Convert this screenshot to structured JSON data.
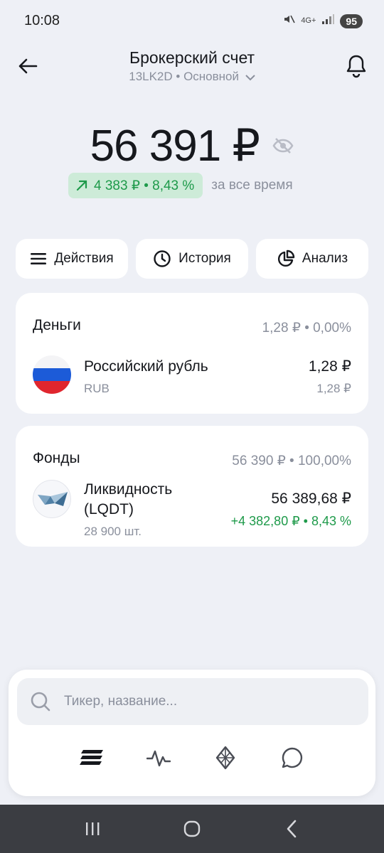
{
  "status_bar": {
    "time": "10:08",
    "network": "4G+",
    "battery": "95"
  },
  "header": {
    "title": "Брокерский счет",
    "account": "13LK2D • Основной"
  },
  "balance": {
    "value": "56 391 ₽",
    "change": "4 383 ₽ • 8,43 %",
    "change_label": "за все время",
    "change_color": "#1e9a4a"
  },
  "actions": [
    {
      "label": "Действия",
      "icon": "menu-icon"
    },
    {
      "label": "История",
      "icon": "clock-icon"
    },
    {
      "label": "Анализ",
      "icon": "pie-chart-icon"
    }
  ],
  "money": {
    "title": "Деньги",
    "summary": "1,28 ₽ • 0,00%",
    "items": [
      {
        "name": "Российский рубль",
        "ticker": "RUB",
        "value": "1,28 ₽",
        "sub_value": "1,28 ₽",
        "icon": "russia-flag-icon"
      }
    ]
  },
  "funds": {
    "title": "Фонды",
    "summary": "56 390 ₽ • 100,00%",
    "items": [
      {
        "name_line1": "Ликвидность",
        "name_line2": "(LQDT)",
        "quantity": "28 900 шт.",
        "value": "56 389,68 ₽",
        "change": "+4 382,80 ₽ • 8,43 %",
        "icon": "lqdt-fund-logo-icon"
      }
    ]
  },
  "search": {
    "placeholder": "Тикер, название..."
  },
  "bottom_nav": [
    "portfolio-icon",
    "pulse-icon",
    "crypto-icon",
    "chat-icon"
  ],
  "colors": {
    "positive": "#1e9a4a",
    "positive_bg": "#cdebd8",
    "muted": "#8a8f9c",
    "background": "#eef0f6"
  }
}
